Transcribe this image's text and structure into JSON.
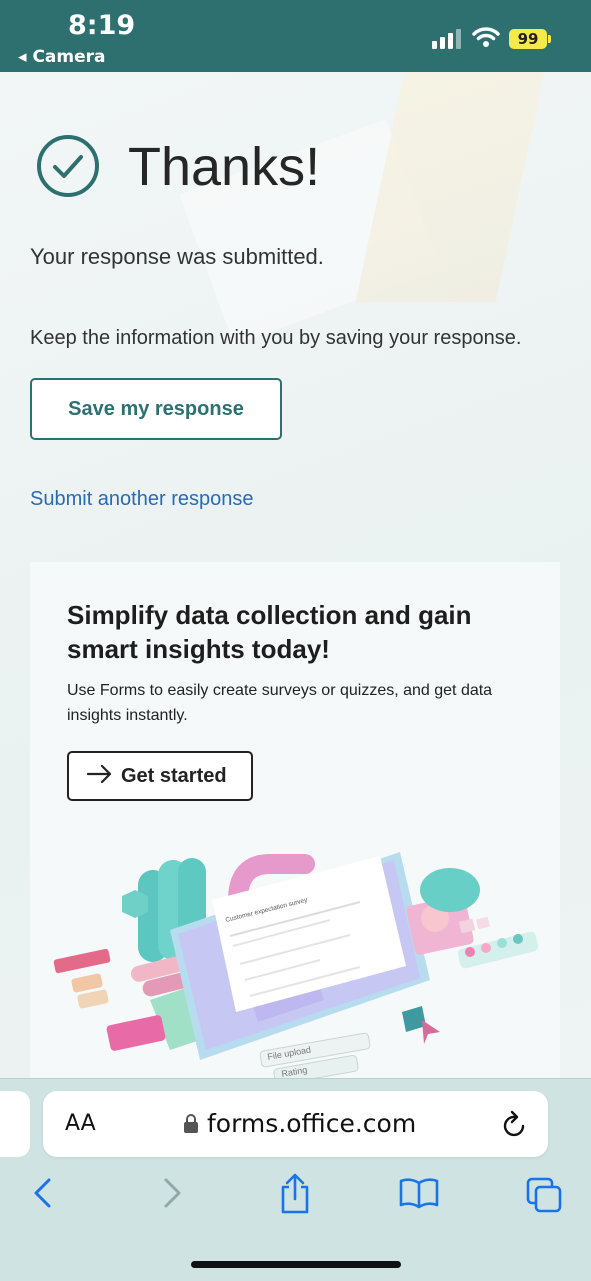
{
  "status_bar": {
    "time": "8:19",
    "back_label": "◂ Camera",
    "battery": "99",
    "icons": [
      "signal-icon",
      "wifi-icon",
      "battery-icon"
    ]
  },
  "confirmation": {
    "title": "Thanks!",
    "message": "Your response was submitted.",
    "keep_info": "Keep the information with you by saving your response.",
    "save_button": "Save my response",
    "submit_another": "Submit another response",
    "icon": "check-circle-icon"
  },
  "promo": {
    "heading": "Simplify data collection and gain smart insights today!",
    "body": "Use Forms to easily create surveys or quizzes, and get data insights instantly.",
    "cta": "Get started",
    "cta_icon": "arrow-right-icon",
    "illustration": {
      "survey_title": "Customer expectation survey",
      "tag_file_upload": "File upload",
      "tag_rating": "Rating"
    }
  },
  "browser": {
    "text_size_label": "AA",
    "url": "forms.office.com",
    "icons": [
      "lock-icon",
      "reload-icon",
      "back-icon",
      "forward-icon",
      "share-icon",
      "bookmarks-icon",
      "tabs-icon"
    ]
  },
  "colors": {
    "brand_teal": "#2e7070",
    "link_blue": "#2a6ab0",
    "battery_yellow": "#f6e94a",
    "safari_blue": "#1a73e8"
  }
}
